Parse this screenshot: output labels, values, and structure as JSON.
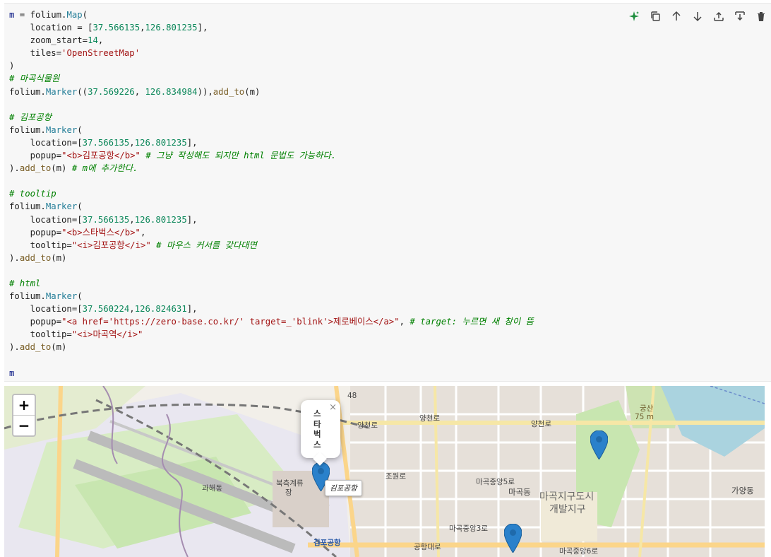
{
  "code_lines": [
    [
      [
        "var",
        "m"
      ],
      [
        "op",
        " = folium."
      ],
      [
        "cls",
        "Map"
      ],
      [
        "op",
        "("
      ]
    ],
    [
      [
        "op",
        "    location = ["
      ],
      [
        "num",
        "37.566135"
      ],
      [
        "op",
        ","
      ],
      [
        "num",
        "126.801235"
      ],
      [
        "op",
        "],"
      ]
    ],
    [
      [
        "op",
        "    zoom_start="
      ],
      [
        "num",
        "14"
      ],
      [
        "op",
        ","
      ]
    ],
    [
      [
        "op",
        "    tiles="
      ],
      [
        "str",
        "'OpenStreetMap'"
      ]
    ],
    [
      [
        "op",
        ")"
      ]
    ],
    [
      [
        "cmt",
        "# 마곡식물원"
      ]
    ],
    [
      [
        "op",
        "folium."
      ],
      [
        "cls",
        "Marker"
      ],
      [
        "op",
        "(("
      ],
      [
        "num",
        "37.569226"
      ],
      [
        "op",
        ", "
      ],
      [
        "num",
        "126.834984"
      ],
      [
        "op",
        ")),"
      ],
      [
        "fn",
        "add_to"
      ],
      [
        "op",
        "(m)"
      ]
    ],
    [
      [
        "op",
        ""
      ]
    ],
    [
      [
        "cmt",
        "# 김포공항"
      ]
    ],
    [
      [
        "op",
        "folium."
      ],
      [
        "cls",
        "Marker"
      ],
      [
        "op",
        "("
      ]
    ],
    [
      [
        "op",
        "    location=["
      ],
      [
        "num",
        "37.566135"
      ],
      [
        "op",
        ","
      ],
      [
        "num",
        "126.801235"
      ],
      [
        "op",
        "],"
      ]
    ],
    [
      [
        "op",
        "    popup="
      ],
      [
        "str",
        "\"<b>김포공항</b>\""
      ],
      [
        "op",
        " "
      ],
      [
        "cmt",
        "# 그냥 작성해도 되지만 html 문법도 가능하다."
      ]
    ],
    [
      [
        "op",
        ")."
      ],
      [
        "fn",
        "add_to"
      ],
      [
        "op",
        "(m) "
      ],
      [
        "cmt",
        "# m에 추가한다."
      ]
    ],
    [
      [
        "op",
        ""
      ]
    ],
    [
      [
        "cmt",
        "# tooltip"
      ]
    ],
    [
      [
        "op",
        "folium."
      ],
      [
        "cls",
        "Marker"
      ],
      [
        "op",
        "("
      ]
    ],
    [
      [
        "op",
        "    location=["
      ],
      [
        "num",
        "37.566135"
      ],
      [
        "op",
        ","
      ],
      [
        "num",
        "126.801235"
      ],
      [
        "op",
        "],"
      ]
    ],
    [
      [
        "op",
        "    popup="
      ],
      [
        "str",
        "\"<b>스타벅스</b>\""
      ],
      [
        "op",
        ","
      ]
    ],
    [
      [
        "op",
        "    tooltip="
      ],
      [
        "str",
        "\"<i>김포공항</i>\""
      ],
      [
        "op",
        " "
      ],
      [
        "cmt",
        "# 마우스 커서를 갖다대면"
      ]
    ],
    [
      [
        "op",
        ")."
      ],
      [
        "fn",
        "add_to"
      ],
      [
        "op",
        "(m)"
      ]
    ],
    [
      [
        "op",
        ""
      ]
    ],
    [
      [
        "cmt",
        "# html"
      ]
    ],
    [
      [
        "op",
        "folium."
      ],
      [
        "cls",
        "Marker"
      ],
      [
        "op",
        "("
      ]
    ],
    [
      [
        "op",
        "    location=["
      ],
      [
        "num",
        "37.560224"
      ],
      [
        "op",
        ","
      ],
      [
        "num",
        "126.824631"
      ],
      [
        "op",
        "],"
      ]
    ],
    [
      [
        "op",
        "    popup="
      ],
      [
        "str",
        "\"<a href='https://zero-base.co.kr/' target=_'blink'>제로베이스</a>\""
      ],
      [
        "op",
        ", "
      ],
      [
        "cmt",
        "# target: 누르면 새 창이 뜸"
      ]
    ],
    [
      [
        "op",
        "    tooltip="
      ],
      [
        "str",
        "\"<i>마곡역</i>\""
      ]
    ],
    [
      [
        "op",
        ")."
      ],
      [
        "fn",
        "add_to"
      ],
      [
        "op",
        "(m)"
      ]
    ],
    [
      [
        "op",
        ""
      ]
    ],
    [
      [
        "var",
        "m"
      ]
    ]
  ],
  "toolbar": {
    "icons": [
      "sparkle-icon",
      "copy-icon",
      "move-up-icon",
      "move-down-icon",
      "insert-above-icon",
      "insert-below-icon",
      "delete-icon"
    ]
  },
  "map": {
    "zoom_in": "+",
    "zoom_out": "−",
    "popup_text": "스타벅스",
    "popup_close": "×",
    "tooltip_text": "김포공항",
    "labels": {
      "yangcheonro_1": "양천로",
      "yangcheonro_2": "양천로",
      "yangcheonro_3": "양천로",
      "gwahaedong": "과해동",
      "magokdong": "마곡동",
      "magok_district": "마곡지구도시",
      "magok_district2": "개발지구",
      "gimpo_airport": "김포공항",
      "gongsan": "궁산",
      "gongsan_elev": "75 m",
      "gayangdong": "가양동",
      "road_48": "48",
      "jowonro": "조원로",
      "magok_jungang5": "마곡중앙5로",
      "magok_jungang3": "마곡중앙3로",
      "gonghang_daero": "공항대로",
      "bukcheuk": "북측계류",
      "bukcheuk2": "장",
      "magok_jungang6": "마곡중앙6로"
    },
    "colors": {
      "marker": "#2a81cb",
      "land": "#f2efe9",
      "airport": "#e9e7f0",
      "park": "#c8e6b0",
      "water": "#aad3df",
      "road": "#fbd58a"
    }
  }
}
